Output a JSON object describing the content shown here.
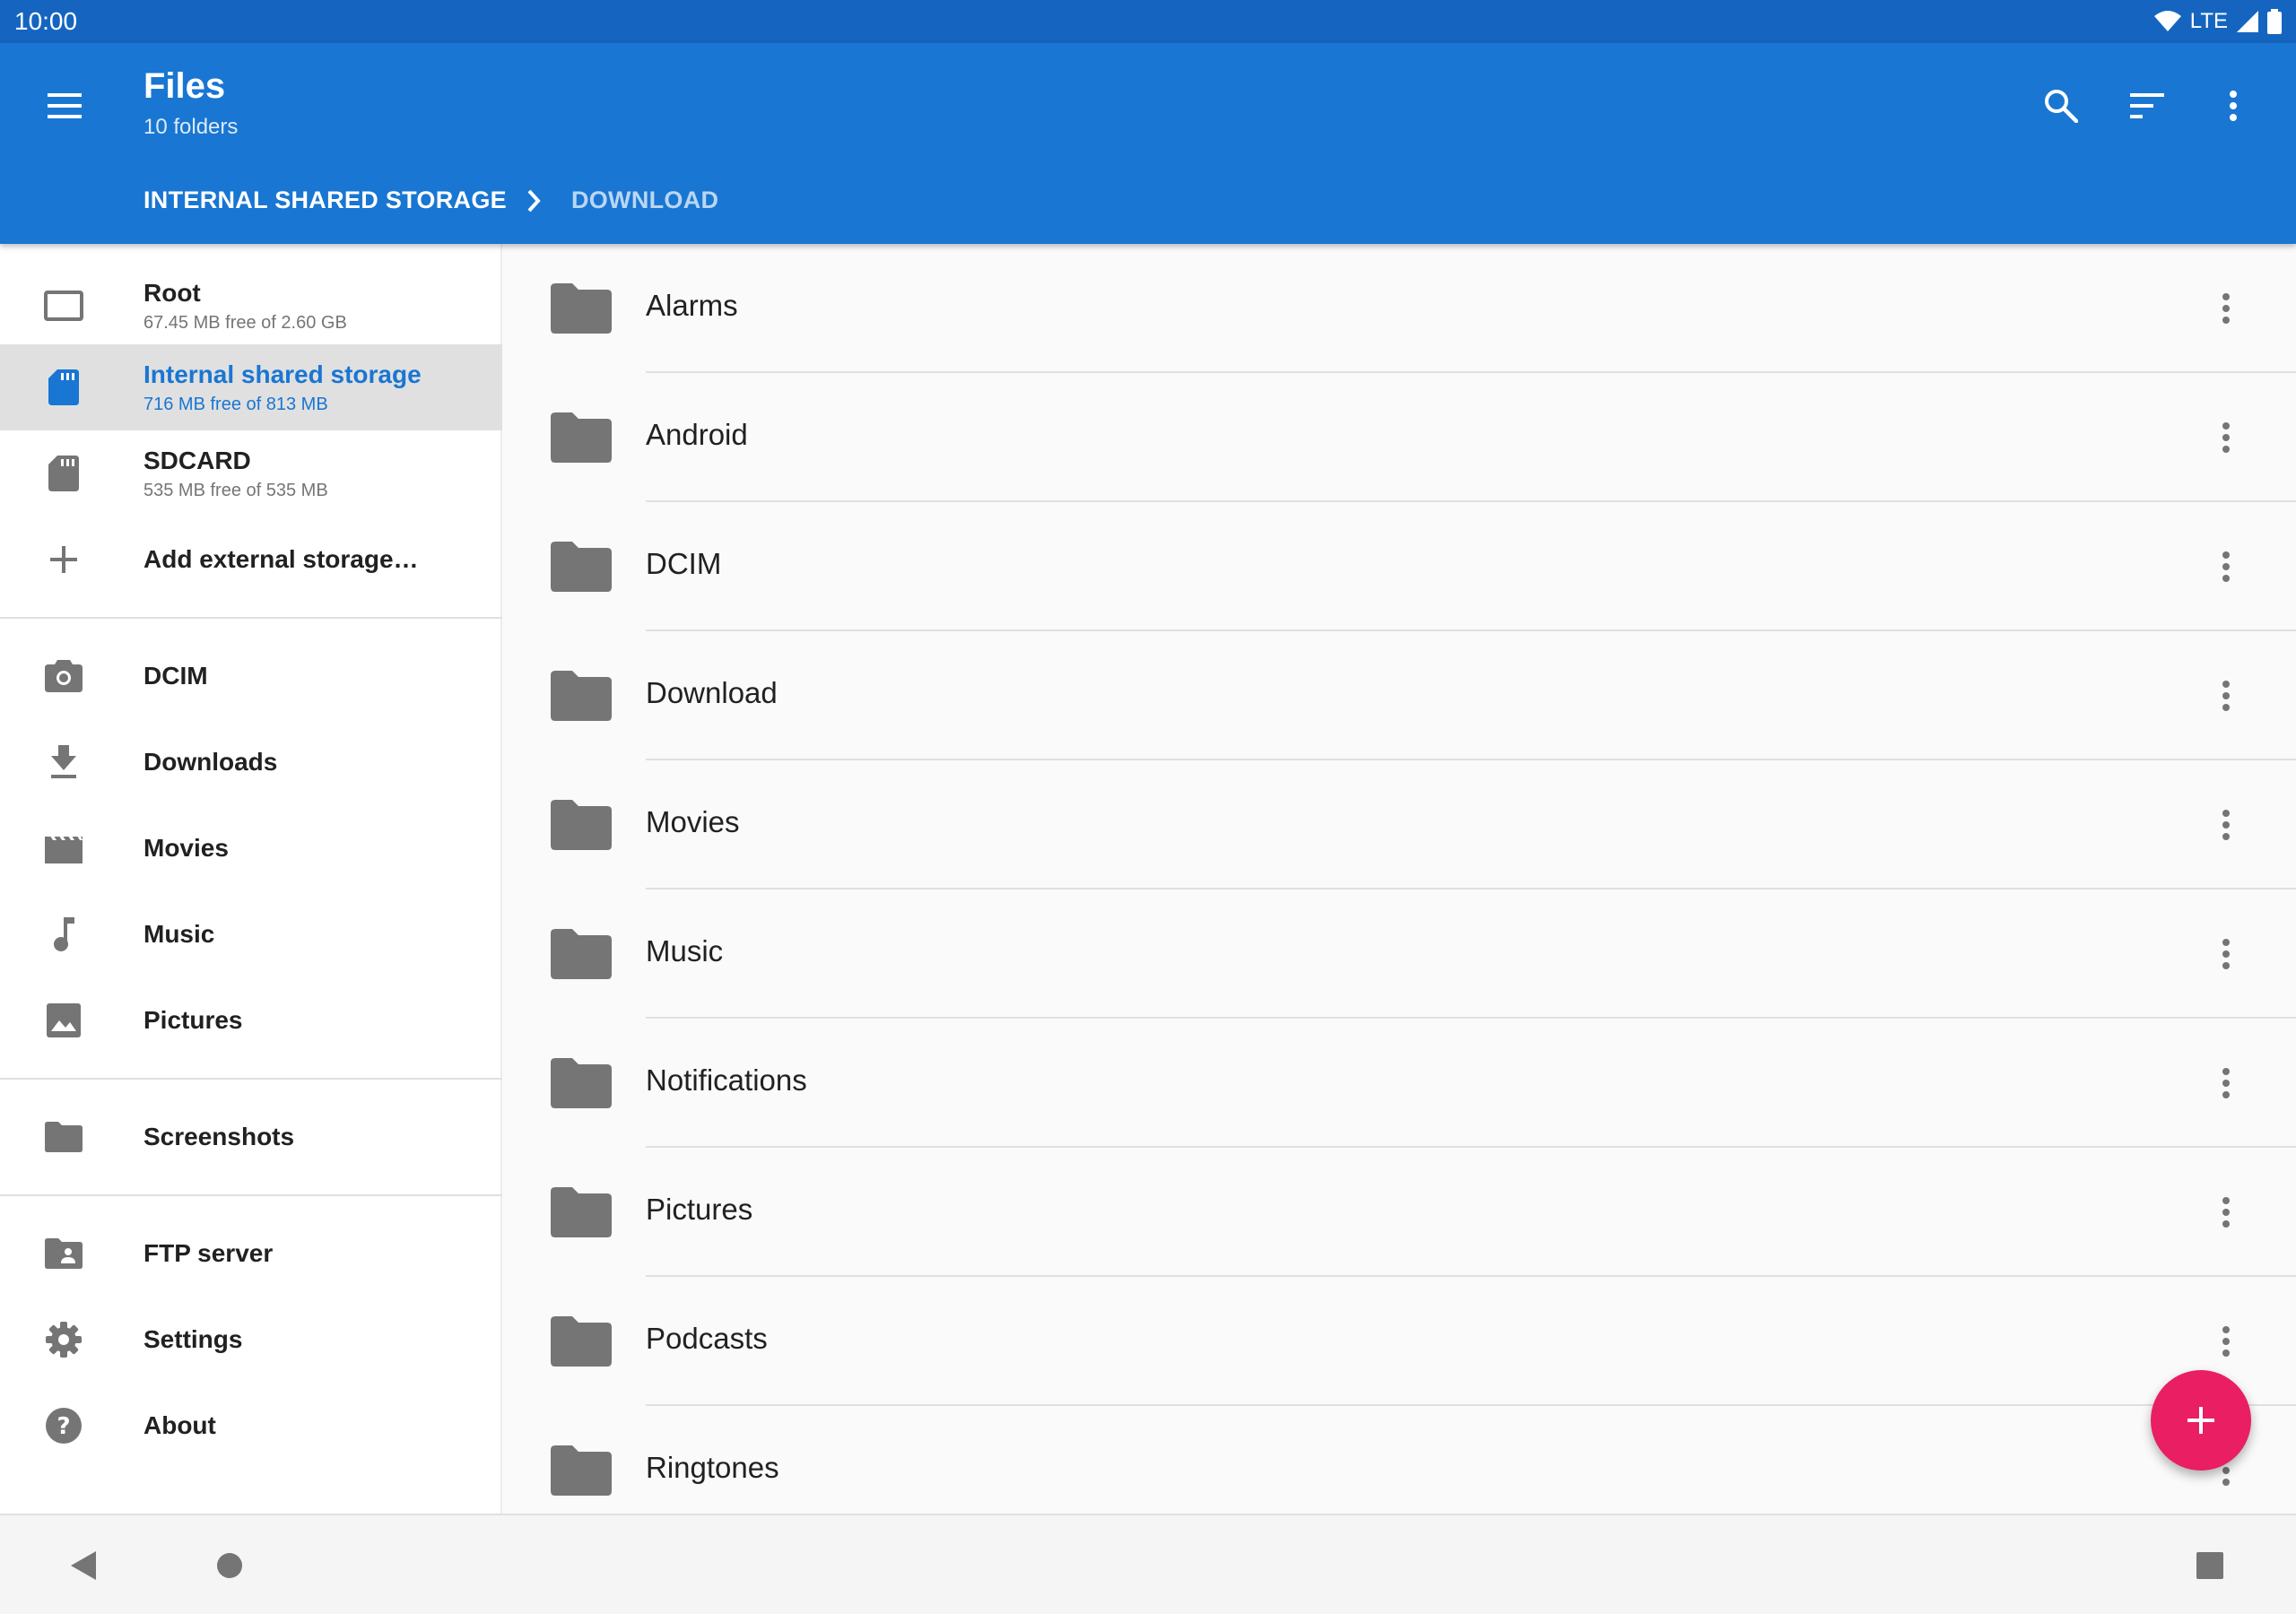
{
  "status_bar": {
    "time": "10:00",
    "network": "LTE"
  },
  "app_bar": {
    "title": "Files",
    "subtitle": "10 folders",
    "breadcrumb": [
      "INTERNAL SHARED STORAGE",
      "DOWNLOAD"
    ],
    "icons": [
      "menu-icon",
      "search-icon",
      "sort-icon",
      "more-vert-icon"
    ]
  },
  "drawer": {
    "storage": [
      {
        "label": "Root",
        "sub": "67.45 MB free of 2.60 GB",
        "icon": "device-icon"
      },
      {
        "label": "Internal shared storage",
        "sub": "716 MB free of 813 MB",
        "icon": "sd-card-icon",
        "selected": true
      },
      {
        "label": "SDCARD",
        "sub": "535 MB free of 535 MB",
        "icon": "sd-card-icon"
      },
      {
        "label": "Add external storage…",
        "icon": "add-icon"
      }
    ],
    "bookmarks": [
      {
        "label": "DCIM",
        "icon": "camera-icon"
      },
      {
        "label": "Downloads",
        "icon": "download-icon"
      },
      {
        "label": "Movies",
        "icon": "movie-icon"
      },
      {
        "label": "Music",
        "icon": "music-note-icon"
      },
      {
        "label": "Pictures",
        "icon": "image-icon"
      }
    ],
    "folders": [
      {
        "label": "Screenshots",
        "icon": "folder-icon"
      }
    ],
    "other": [
      {
        "label": "FTP server",
        "icon": "folder-shared-icon"
      },
      {
        "label": "Settings",
        "icon": "settings-icon"
      },
      {
        "label": "About",
        "icon": "help-icon"
      }
    ]
  },
  "files": [
    "Alarms",
    "Android",
    "DCIM",
    "Download",
    "Movies",
    "Music",
    "Notifications",
    "Pictures",
    "Podcasts",
    "Ringtones"
  ],
  "fab": {
    "icon": "add-icon"
  },
  "colors": {
    "primary": "#1976d2",
    "primary_dark": "#1565c0",
    "accent": "#e91e63"
  }
}
